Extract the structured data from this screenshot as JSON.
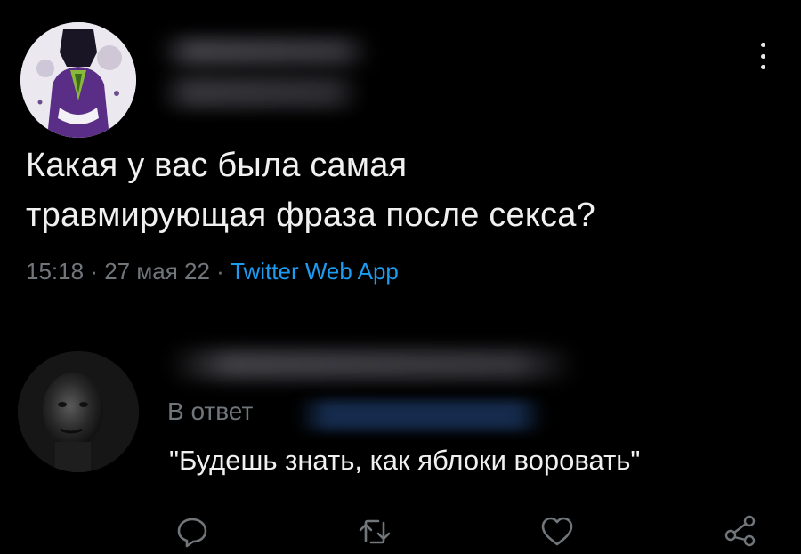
{
  "tweet": {
    "author_avatar": "purple-figure-avatar",
    "text_line1": "Какая у вас была самая",
    "text_line2": "травмирующая фраза после секса?",
    "time": "15:18",
    "separator": "·",
    "date": "27 мая 22",
    "source": "Twitter Web App",
    "source_color": "#1d9bf0"
  },
  "reply": {
    "author_avatar": "dark-photo-avatar",
    "reply_to_label": "В ответ",
    "text": "\"Будешь знать, как яблоки воровать\""
  },
  "actions": {
    "reply_icon": "comment-icon",
    "retweet_icon": "retweet-icon",
    "like_icon": "heart-icon",
    "share_icon": "share-icon"
  },
  "colors": {
    "background": "#000000",
    "text": "#e7e9ea",
    "secondary": "#71767b",
    "accent": "#1d9bf0"
  }
}
